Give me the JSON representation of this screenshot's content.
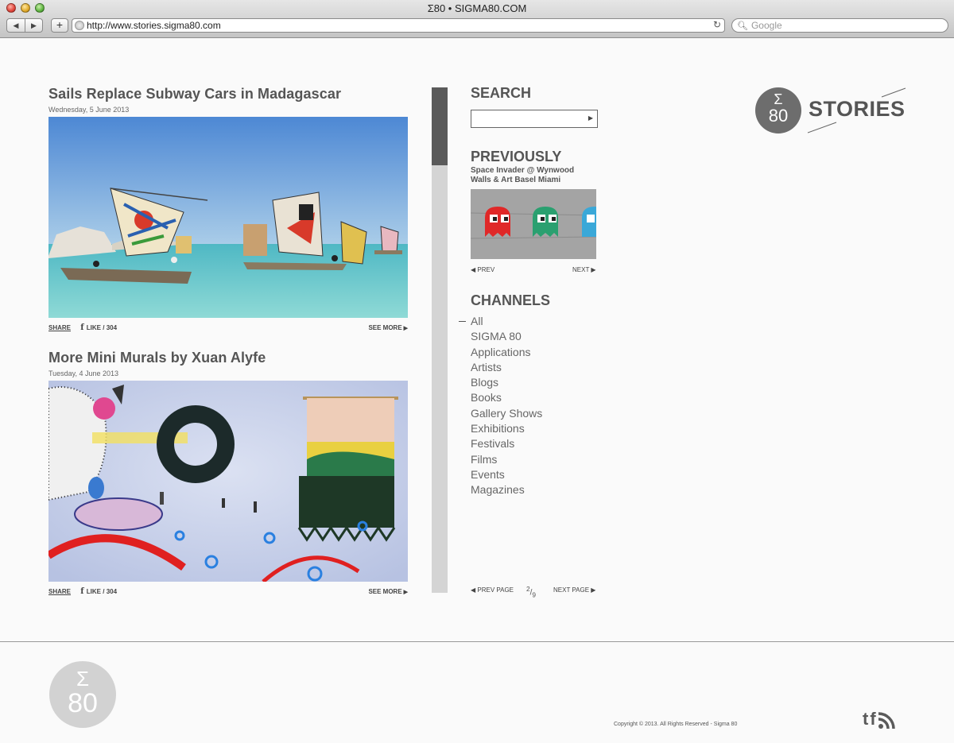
{
  "window": {
    "title": "Σ80 • SIGMA80.COM"
  },
  "toolbar": {
    "back": "◀",
    "forward": "▶",
    "add": "+",
    "url": "http://www.stories.sigma80.com",
    "reload": "↻",
    "search_placeholder": "Google"
  },
  "posts": [
    {
      "title": "Sails Replace Subway Cars in Madagascar",
      "date": "Wednesday, 5 June 2013",
      "share": "SHARE",
      "like": "LIKE",
      "like_count": "/ 304",
      "see_more": "SEE MORE"
    },
    {
      "title": "More Mini Murals by Xuan Alyfe",
      "date": "Tuesday, 4 June 2013",
      "share": "SHARE",
      "like": "LIKE",
      "like_count": "/ 304",
      "see_more": "SEE MORE"
    }
  ],
  "sidebar": {
    "search_heading": "SEARCH",
    "search_go": "▶",
    "previously_heading": "PREVIOUSLY",
    "previously_caption": "Space Invader @ Wynwood Walls & Art Basel Miami",
    "prev": "◀ PREV",
    "next": "NEXT ▶",
    "channels_heading": "CHANNELS",
    "channels": [
      "All",
      "SIGMA 80",
      "Applications",
      "Artists",
      "Blogs",
      "Books",
      "Gallery Shows",
      "Exhibitions",
      "Festivals",
      "Films",
      "Events",
      "Magazines"
    ],
    "prev_page": "◀ PREV PAGE",
    "page_num": "2",
    "page_total": "9",
    "next_page": "NEXT PAGE ▶"
  },
  "logo": {
    "sigma": "Σ",
    "number": "80",
    "text": "STORIES"
  },
  "footer": {
    "sigma": "Σ",
    "number": "80",
    "copyright": "Copyright © 2013. All Rights Reserved - Sigma 80",
    "social": [
      "t",
      "f"
    ]
  }
}
